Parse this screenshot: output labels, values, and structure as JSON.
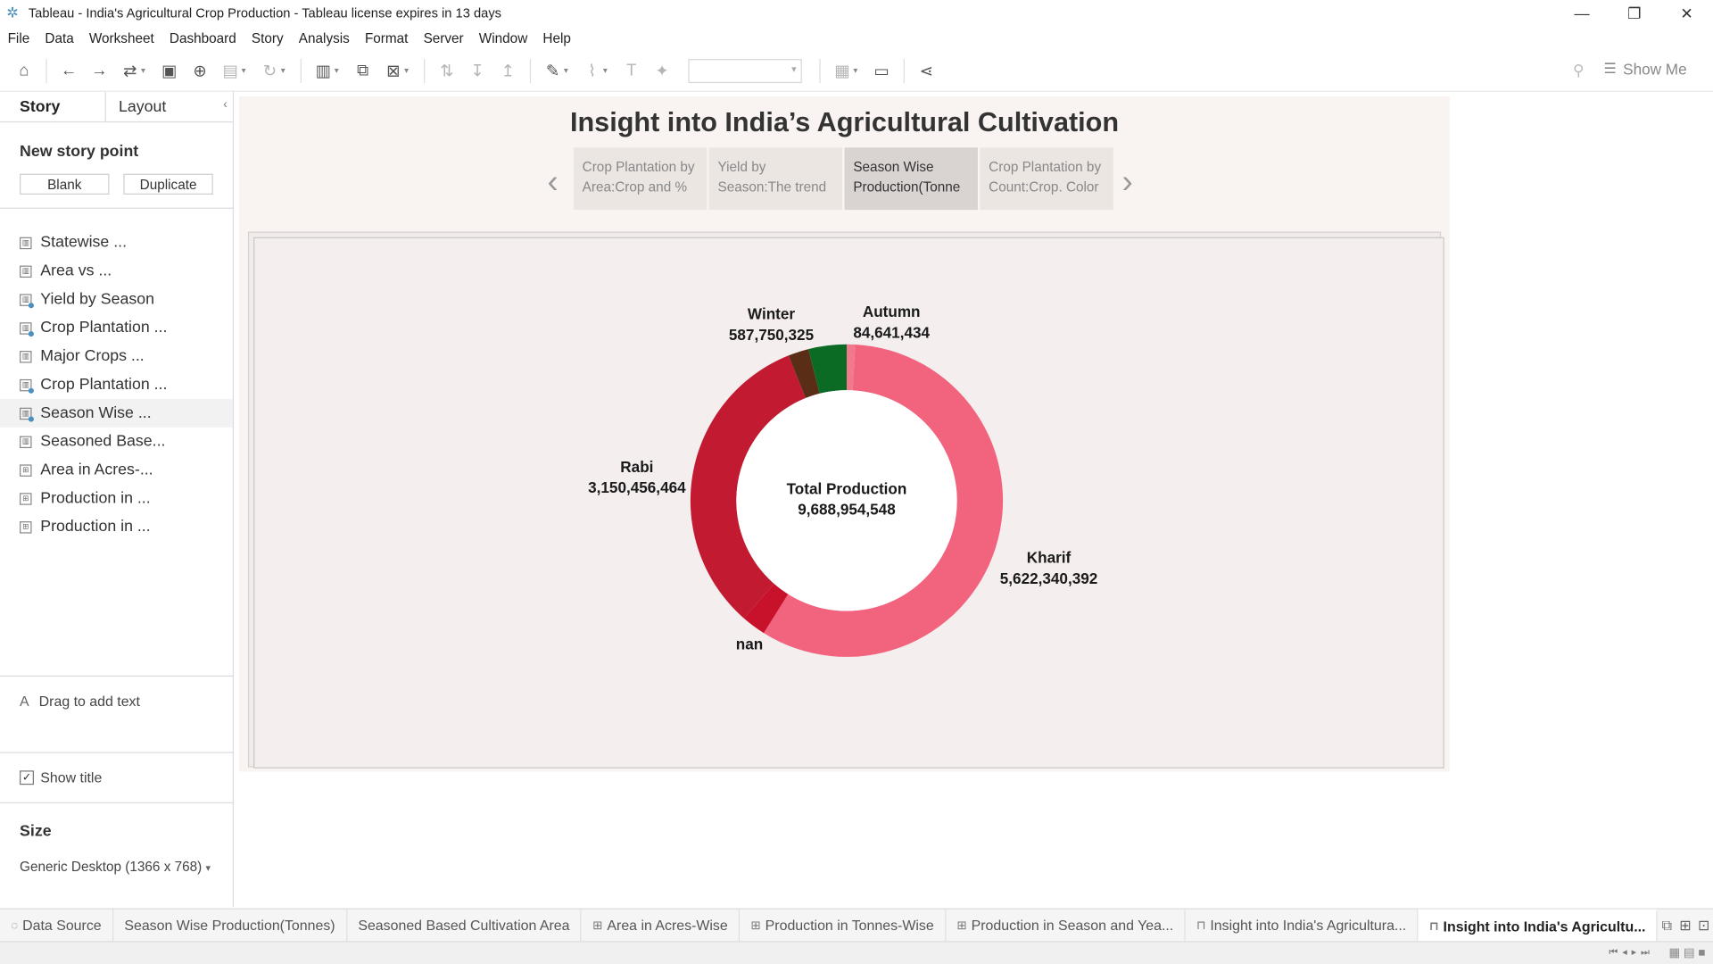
{
  "window": {
    "title": "Tableau - India's Agricultural Crop Production - Tableau license expires in 13 days",
    "controls": {
      "minimize": "—",
      "restore": "❐",
      "close": "✕"
    }
  },
  "menu": [
    "File",
    "Data",
    "Worksheet",
    "Dashboard",
    "Story",
    "Analysis",
    "Format",
    "Server",
    "Window",
    "Help"
  ],
  "toolbar": {
    "show_me": "Show Me"
  },
  "sidebar": {
    "tab_story": "Story",
    "tab_layout": "Layout",
    "new_story_point": "New story point",
    "blank": "Blank",
    "duplicate": "Duplicate",
    "sheets": [
      {
        "label": "Statewise ...",
        "kind": "sheet"
      },
      {
        "label": "Area vs ...",
        "kind": "sheet"
      },
      {
        "label": "Yield by Season",
        "kind": "dashboard"
      },
      {
        "label": "Crop Plantation ...",
        "kind": "dashboard"
      },
      {
        "label": "Major Crops ...",
        "kind": "sheet"
      },
      {
        "label": "Crop Plantation ...",
        "kind": "dashboard"
      },
      {
        "label": "Season Wise ...",
        "kind": "dashboard"
      },
      {
        "label": "Seasoned Base...",
        "kind": "sheet"
      },
      {
        "label": "Area in Acres-...",
        "kind": "table"
      },
      {
        "label": "Production in ...",
        "kind": "table"
      },
      {
        "label": "Production in ...",
        "kind": "table"
      }
    ],
    "drag_text": "Drag to add text",
    "show_title": "Show title",
    "size_heading": "Size",
    "size_value": "Generic Desktop (1366 x 768)"
  },
  "story": {
    "title": "Insight into India’s Agricultural Cultivation",
    "points": [
      {
        "label": "Crop Plantation by Area:Crop and %",
        "active": false
      },
      {
        "label": "Yield by Season:The trend",
        "active": false
      },
      {
        "label": "Season Wise Production(Tonne",
        "active": true
      },
      {
        "label": "Crop Plantation by Count:Crop. Color",
        "active": false
      }
    ]
  },
  "chart_data": {
    "type": "pie",
    "subtype": "donut",
    "center_label": "Total Production",
    "center_value": "9,688,954,548",
    "total": 9688954548,
    "slices": [
      {
        "name": "Kharif",
        "value": 5622340392,
        "label_value": "5,622,340,392",
        "color": "#f2637d"
      },
      {
        "name": "nan",
        "value": 243765933,
        "label_value": "",
        "color": "#c8122c"
      },
      {
        "name": "Rabi",
        "value": 3150456464,
        "label_value": "3,150,456,464",
        "color": "#c21a31"
      },
      {
        "name": "Winter",
        "value": 587750325,
        "label_value": "587,750,325",
        "color": "#5a2d16",
        "split_color": "#0b6b24"
      },
      {
        "name": "Autumn",
        "value": 84641434,
        "label_value": "84,641,434",
        "color": "#f07a8c"
      }
    ],
    "colors": {
      "Kharif": "#f2637d",
      "Rabi": "#c21a31",
      "Winter": "#0b6b24",
      "Autumn": "#f07a8c",
      "nan": "#c8122c"
    }
  },
  "bottom_tabs": [
    {
      "label": "Data Source",
      "icon": "datasource-icon"
    },
    {
      "label": "Season Wise Production(Tonnes)",
      "icon": ""
    },
    {
      "label": "Seasoned Based Cultivation Area",
      "icon": ""
    },
    {
      "label": "Area in Acres-Wise",
      "icon": "table-icon"
    },
    {
      "label": "Production in Tonnes-Wise",
      "icon": "table-icon"
    },
    {
      "label": "Production in Season and Yea...",
      "icon": "table-icon"
    },
    {
      "label": "Insight into India's Agricultura...",
      "icon": "story-icon"
    },
    {
      "label": "Insight into India's Agricultu...",
      "icon": "story-icon",
      "active": true
    }
  ]
}
